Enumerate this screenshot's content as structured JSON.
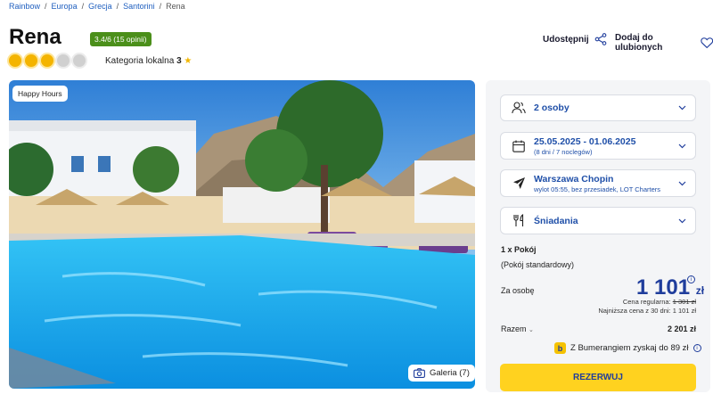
{
  "breadcrumb": [
    "Rainbow",
    "Europa",
    "Grecja",
    "Santorini",
    "Rena"
  ],
  "hotel": {
    "name": "Rena",
    "rating": "3.4/6 (15 opinii)",
    "suns_on": 3,
    "suns_total": 5,
    "category_label": "Kategoria lokalna",
    "category_value": "3",
    "category_star": "★"
  },
  "actions": {
    "share": "Udostępnij",
    "favorite": "Dodaj do ulubionych"
  },
  "photo": {
    "badge": "Happy Hours",
    "gallery": "Galeria (7)"
  },
  "booking": {
    "persons": "2 osoby",
    "dates": "25.05.2025 - 01.06.2025",
    "dates_sub": "(8 dni / 7 noclegów)",
    "airport": "Warszawa Chopin",
    "airport_sub": "wylot 05:55, bez przesiadek, LOT Charters",
    "meal": "Śniadania",
    "room_count": "1 x Pokój",
    "room_type": "(Pokój standardowy)",
    "per_person_label": "Za osobę",
    "price": "1 101",
    "currency": "zł",
    "regular_label": "Cena regularna:",
    "regular_price": "1 301 zł",
    "lowest": "Najniższa cena z 30 dni: 1 101 zł",
    "total_label": "Razem",
    "total_value": "2 201 zł",
    "boomerang": "Z Bumerangiem zyskaj do 89 zł",
    "reserve": "REZERWUJ"
  },
  "colors": {
    "accent": "#1f3d9c",
    "rating_bg": "#4b8f1a",
    "cta": "#ffd21f"
  }
}
